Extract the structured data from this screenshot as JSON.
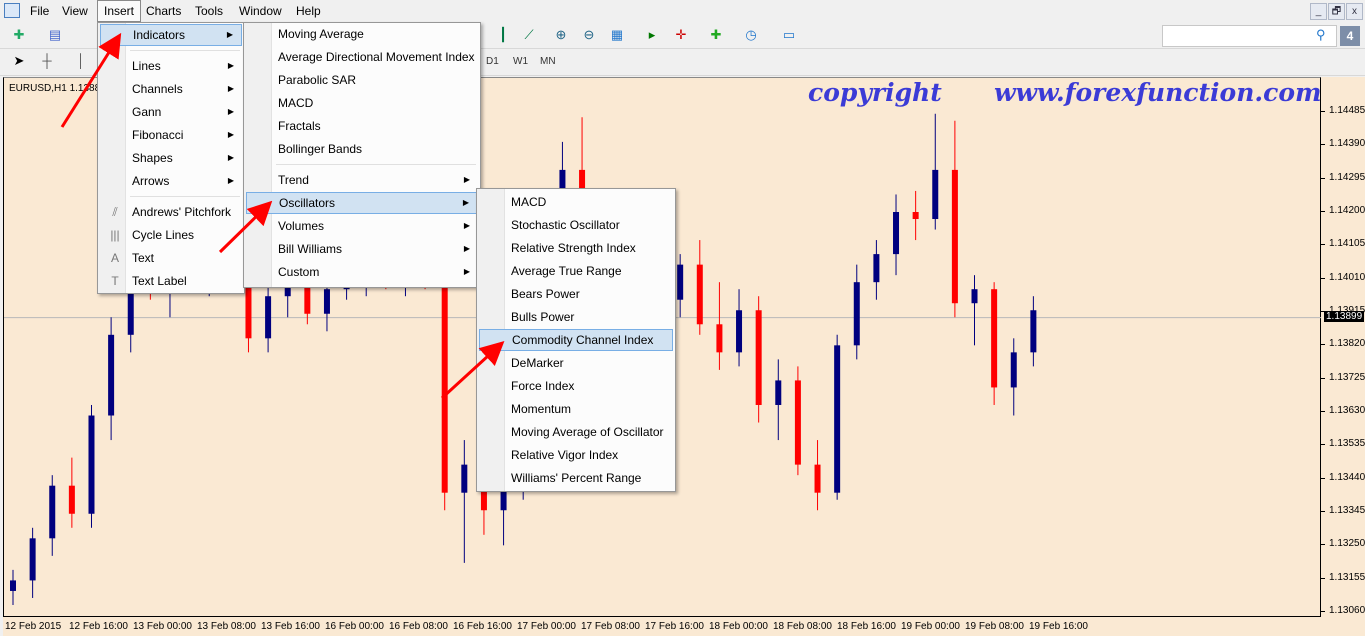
{
  "menubar": {
    "items": [
      "File",
      "View",
      "Insert",
      "Charts",
      "Tools",
      "Window",
      "Help"
    ],
    "active": "Insert"
  },
  "window_controls": [
    "_",
    "🗗",
    "x"
  ],
  "timeframes": [
    "D1",
    "W1",
    "MN"
  ],
  "search": {
    "value": "",
    "badge": "4"
  },
  "chart": {
    "symbol_label": "EURUSD,H1  1.1388",
    "watermark": "copyright      www.forexfunction.com",
    "current_price": "1.13899",
    "price_ticks": [
      "1.14485",
      "1.14390",
      "1.14295",
      "1.14200",
      "1.14105",
      "1.14010",
      "1.13915",
      "1.13820",
      "1.13725",
      "1.13630",
      "1.13535",
      "1.13440",
      "1.13345",
      "1.13250",
      "1.13155",
      "1.13060"
    ],
    "time_ticks": [
      "12 Feb 2015",
      "12 Feb 16:00",
      "13 Feb 00:00",
      "13 Feb 08:00",
      "13 Feb 16:00",
      "16 Feb 00:00",
      "16 Feb 08:00",
      "16 Feb 16:00",
      "17 Feb 00:00",
      "17 Feb 08:00",
      "17 Feb 16:00",
      "18 Feb 00:00",
      "18 Feb 08:00",
      "18 Feb 16:00",
      "19 Feb 00:00",
      "19 Feb 08:00",
      "19 Feb 16:00"
    ],
    "colors": {
      "bull": "#00007f",
      "bear": "#ff0000",
      "background": "#fae9d3"
    },
    "candles": [
      [
        1.1312,
        1.1318,
        1.1308,
        1.1315
      ],
      [
        1.1315,
        1.133,
        1.131,
        1.1327
      ],
      [
        1.1327,
        1.1345,
        1.1322,
        1.1342
      ],
      [
        1.1342,
        1.135,
        1.133,
        1.1334
      ],
      [
        1.1334,
        1.1365,
        1.133,
        1.1362
      ],
      [
        1.1362,
        1.139,
        1.1355,
        1.1385
      ],
      [
        1.1385,
        1.1418,
        1.138,
        1.1412
      ],
      [
        1.1412,
        1.1425,
        1.1395,
        1.1398
      ],
      [
        1.1398,
        1.141,
        1.139,
        1.1405
      ],
      [
        1.1405,
        1.1415,
        1.1398,
        1.1402
      ],
      [
        1.1402,
        1.1412,
        1.1396,
        1.1408
      ],
      [
        1.1408,
        1.1418,
        1.14,
        1.1404
      ],
      [
        1.1404,
        1.1406,
        1.138,
        1.1384
      ],
      [
        1.1384,
        1.14,
        1.138,
        1.1396
      ],
      [
        1.1396,
        1.1404,
        1.139,
        1.1401
      ],
      [
        1.1401,
        1.1405,
        1.1388,
        1.1391
      ],
      [
        1.1391,
        1.1402,
        1.1386,
        1.1398
      ],
      [
        1.1398,
        1.1405,
        1.1395,
        1.14
      ],
      [
        1.14,
        1.1404,
        1.1396,
        1.1402
      ],
      [
        1.1402,
        1.1406,
        1.1398,
        1.14
      ],
      [
        1.14,
        1.1405,
        1.1396,
        1.1403
      ],
      [
        1.1403,
        1.1406,
        1.1398,
        1.1401
      ],
      [
        1.1401,
        1.1404,
        1.1335,
        1.134
      ],
      [
        1.134,
        1.1355,
        1.132,
        1.1348
      ],
      [
        1.1348,
        1.1352,
        1.1328,
        1.1335
      ],
      [
        1.1335,
        1.1348,
        1.1325,
        1.1344
      ],
      [
        1.1344,
        1.1356,
        1.1338,
        1.135
      ],
      [
        1.135,
        1.1365,
        1.1345,
        1.136
      ],
      [
        1.136,
        1.144,
        1.1355,
        1.1432
      ],
      [
        1.1432,
        1.1447,
        1.141,
        1.1415
      ],
      [
        1.1415,
        1.1425,
        1.1395,
        1.1402
      ],
      [
        1.1402,
        1.142,
        1.1398,
        1.1416
      ],
      [
        1.1416,
        1.142,
        1.1395,
        1.1398
      ],
      [
        1.1398,
        1.141,
        1.1392,
        1.1395
      ],
      [
        1.1395,
        1.1408,
        1.139,
        1.1405
      ],
      [
        1.1405,
        1.1412,
        1.1385,
        1.1388
      ],
      [
        1.1388,
        1.14,
        1.1375,
        1.138
      ],
      [
        1.138,
        1.1398,
        1.1376,
        1.1392
      ],
      [
        1.1392,
        1.1396,
        1.136,
        1.1365
      ],
      [
        1.1365,
        1.1378,
        1.1355,
        1.1372
      ],
      [
        1.1372,
        1.1376,
        1.1345,
        1.1348
      ],
      [
        1.1348,
        1.1355,
        1.1335,
        1.134
      ],
      [
        1.134,
        1.1385,
        1.1338,
        1.1382
      ],
      [
        1.1382,
        1.1405,
        1.1378,
        1.14
      ],
      [
        1.14,
        1.1412,
        1.1395,
        1.1408
      ],
      [
        1.1408,
        1.1425,
        1.1402,
        1.142
      ],
      [
        1.142,
        1.1426,
        1.1412,
        1.1418
      ],
      [
        1.1418,
        1.1448,
        1.1415,
        1.1432
      ],
      [
        1.1432,
        1.1446,
        1.139,
        1.1394
      ],
      [
        1.1394,
        1.1402,
        1.1382,
        1.1398
      ],
      [
        1.1398,
        1.14,
        1.1365,
        1.137
      ],
      [
        1.137,
        1.1384,
        1.1362,
        1.138
      ],
      [
        1.138,
        1.1396,
        1.1376,
        1.1392
      ]
    ]
  },
  "insert_menu": {
    "items": [
      {
        "label": "Indicators",
        "submenu": true,
        "highlight": true
      },
      {
        "label": "Lines",
        "submenu": true
      },
      {
        "label": "Channels",
        "submenu": true
      },
      {
        "label": "Gann",
        "submenu": true
      },
      {
        "label": "Fibonacci",
        "submenu": true
      },
      {
        "label": "Shapes",
        "submenu": true
      },
      {
        "label": "Arrows",
        "submenu": true
      },
      {
        "label": "Andrews' Pitchfork",
        "icon": "pitchfork-icon"
      },
      {
        "label": "Cycle Lines",
        "icon": "cycle-lines-icon"
      },
      {
        "label": "Text",
        "icon": "text-icon"
      },
      {
        "label": "Text Label",
        "icon": "text-label-icon"
      }
    ]
  },
  "indicators_menu": {
    "items": [
      {
        "label": "Moving Average"
      },
      {
        "label": "Average Directional Movement Index"
      },
      {
        "label": "Parabolic SAR"
      },
      {
        "label": "MACD"
      },
      {
        "label": "Fractals"
      },
      {
        "label": "Bollinger Bands"
      },
      {
        "label": "Trend",
        "submenu": true
      },
      {
        "label": "Oscillators",
        "submenu": true,
        "highlight": true
      },
      {
        "label": "Volumes",
        "submenu": true
      },
      {
        "label": "Bill Williams",
        "submenu": true
      },
      {
        "label": "Custom",
        "submenu": true
      }
    ]
  },
  "oscillators_menu": {
    "items": [
      {
        "label": "MACD"
      },
      {
        "label": "Stochastic Oscillator"
      },
      {
        "label": "Relative Strength Index"
      },
      {
        "label": "Average True Range"
      },
      {
        "label": "Bears Power"
      },
      {
        "label": "Bulls Power"
      },
      {
        "label": "Commodity Channel Index",
        "highlight": true
      },
      {
        "label": "DeMarker"
      },
      {
        "label": "Force Index"
      },
      {
        "label": "Momentum"
      },
      {
        "label": "Moving Average of Oscillator"
      },
      {
        "label": "Relative Vigor Index"
      },
      {
        "label": "Williams' Percent Range"
      }
    ]
  }
}
